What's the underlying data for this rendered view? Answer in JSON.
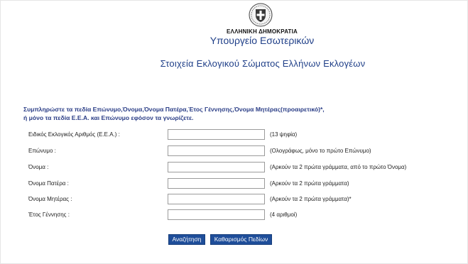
{
  "header": {
    "emblem_icon": "greek-coat-of-arms-icon",
    "government": "ΕΛΛΗΝΙΚΗ ΔΗΜΟΚΡΑΤΙΑ",
    "ministry": "Υπουργείο Εσωτερικών",
    "title": "Στοιχεία Εκλογικού Σώματος Ελλήνων Εκλογέων"
  },
  "instructions": {
    "line1": "Συμπληρώστε τα πεδία Επώνυμο,Όνομα,Όνομα Πατέρα,Έτος Γέννησης,Όνομα Μητέρας(προαιρετικό)*,",
    "line2": "ή μόνο τα πεδία Ε.Ε.Α. και Επώνυμο εφόσον τα γνωρίζετε."
  },
  "form": {
    "fields": [
      {
        "label": "Ειδικός Εκλογικός Αριθμός (Ε.Ε.Α.) :",
        "value": "",
        "hint": "(13 ψηφία)"
      },
      {
        "label": "Επώνυμο :",
        "value": "",
        "hint": "(Ολογράφως, μόνο το πρώτο Επώνυμο)"
      },
      {
        "label": "Όνομα :",
        "value": "",
        "hint": "(Αρκούν τα 2 πρώτα γράμματα, από το πρώτο Όνομα)"
      },
      {
        "label": "Όνομα Πατέρα :",
        "value": "",
        "hint": "(Αρκούν τα 2 πρώτα γράμματα)"
      },
      {
        "label": "Όνομα Μητέρας :",
        "value": "",
        "hint": "(Αρκούν τα 2 πρώτα γράμματα)*"
      },
      {
        "label": "Έτος Γέννησης :",
        "value": "",
        "hint": "(4 αριθμοί)"
      }
    ],
    "search_label": "Αναζήτηση",
    "clear_label": "Καθαρισμός Πεδίων"
  },
  "colors": {
    "accent": "#1f3f88",
    "button": "#1f4e9a"
  }
}
